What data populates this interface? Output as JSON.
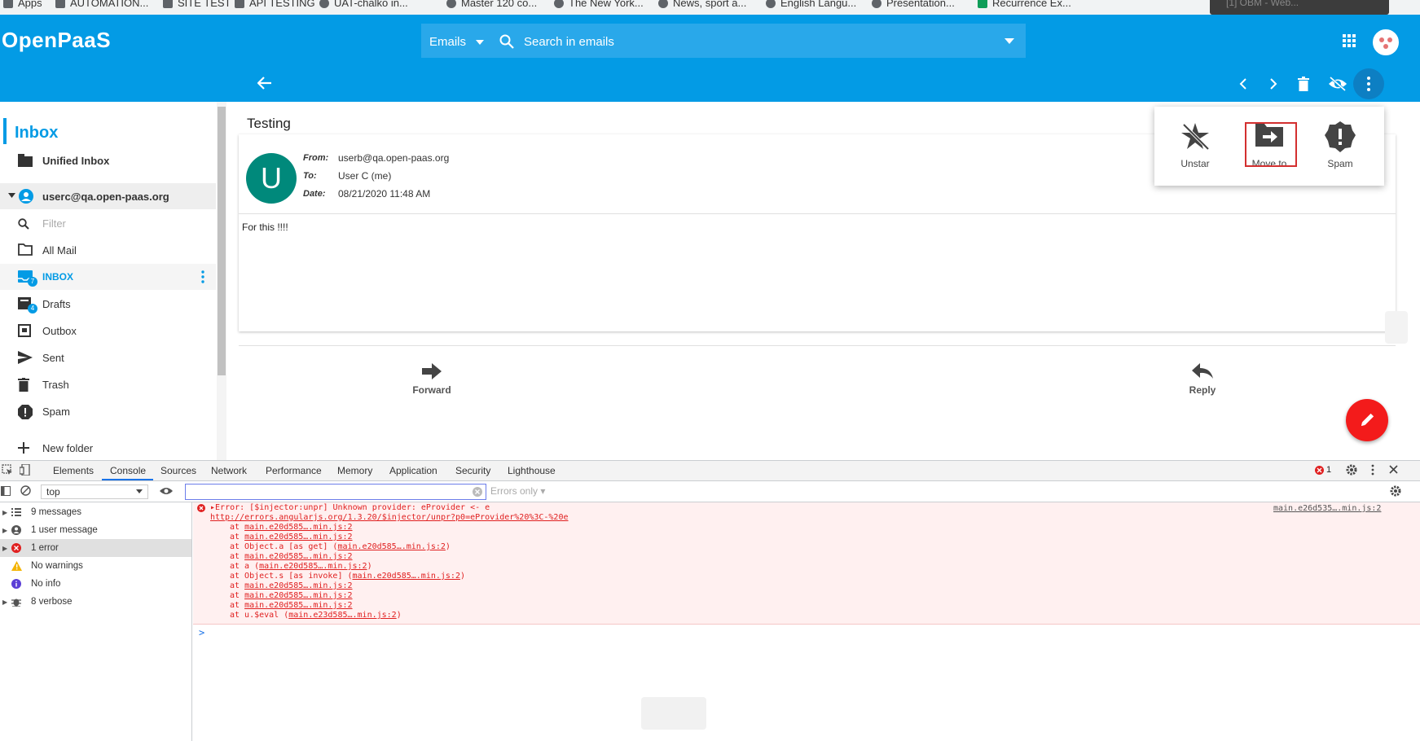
{
  "bookmarks": [
    {
      "label": "Apps"
    },
    {
      "label": "AUTOMATION..."
    },
    {
      "label": "SITE TEST"
    },
    {
      "label": "API TESTING"
    },
    {
      "label": "UAT-chalko in..."
    },
    {
      "label": "Master 120 co..."
    },
    {
      "label": "The New York..."
    },
    {
      "label": "News, sport a..."
    },
    {
      "label": "English Langu..."
    },
    {
      "label": "Presentation..."
    },
    {
      "label": "Recurrence Ex..."
    }
  ],
  "tooltip": "[1] OBM - Web...",
  "app": {
    "logo": "OpenPaaS",
    "search_scope": "Emails",
    "search_placeholder": "Search in emails"
  },
  "sidebar": {
    "title": "Inbox",
    "unified": "Unified Inbox",
    "account": "userc@qa.open-paas.org",
    "filter_placeholder": "Filter",
    "folders": [
      {
        "label": "All Mail",
        "icon": "folder-icon"
      },
      {
        "label": "INBOX",
        "icon": "inbox-icon",
        "badge": "7"
      },
      {
        "label": "Drafts",
        "icon": "drafts-icon",
        "badge": "4"
      },
      {
        "label": "Outbox",
        "icon": "outbox-icon"
      },
      {
        "label": "Sent",
        "icon": "send-icon"
      },
      {
        "label": "Trash",
        "icon": "trash-icon"
      },
      {
        "label": "Spam",
        "icon": "spam-icon"
      }
    ],
    "new_folder": "New folder"
  },
  "mail": {
    "subject": "Testing",
    "avatar_letter": "U",
    "from_label": "From:",
    "from": "userb@qa.open-paas.org",
    "to_label": "To:",
    "to": "User C (me)",
    "date_label": "Date:",
    "date": "08/21/2020 11:48 AM",
    "body": "For this !!!!",
    "forward": "Forward",
    "reply": "Reply"
  },
  "menu": {
    "unstar": "Unstar",
    "move_to": "Move to",
    "spam": "Spam"
  },
  "devtools": {
    "tabs": [
      "Elements",
      "Console",
      "Sources",
      "Network",
      "Performance",
      "Memory",
      "Application",
      "Security",
      "Lighthouse"
    ],
    "error_count": "1",
    "context": "top",
    "levels": "Errors only",
    "side": [
      {
        "label": "9 messages"
      },
      {
        "label": "1 user message"
      },
      {
        "label": "1 error"
      },
      {
        "label": "No warnings"
      },
      {
        "label": "No info"
      },
      {
        "label": "8 verbose"
      }
    ],
    "error_head": "Error: [$injector:unpr] Unknown provider: eProvider <- e",
    "error_url": "http://errors.angularjs.org/1.3.20/$injector/unpr?p0=eProvider%20%3C-%20e",
    "error_source": "main.e26d535….min.js:2",
    "stack": [
      {
        "pre": "at ",
        "link": "main.e20d585….min.js:2",
        "post": ""
      },
      {
        "pre": "at ",
        "link": "main.e20d585….min.js:2",
        "post": ""
      },
      {
        "pre": "at Object.a [as get] (",
        "link": "main.e20d585….min.js:2",
        "post": ")"
      },
      {
        "pre": "at ",
        "link": "main.e20d585….min.js:2",
        "post": ""
      },
      {
        "pre": "at a (",
        "link": "main.e20d585….min.js:2",
        "post": ")"
      },
      {
        "pre": "at Object.s [as invoke] (",
        "link": "main.e20d585….min.js:2",
        "post": ")"
      },
      {
        "pre": "at ",
        "link": "main.e20d585….min.js:2",
        "post": ""
      },
      {
        "pre": "at ",
        "link": "main.e20d585….min.js:2",
        "post": ""
      },
      {
        "pre": "at ",
        "link": "main.e20d585….min.js:2",
        "post": ""
      },
      {
        "pre": "at u.$eval (",
        "link": "main.e23d585….min.js:2",
        "post": ")"
      }
    ],
    "prompt": ">"
  },
  "colors": {
    "primary": "#039be5",
    "fab": "#f31b1b",
    "avatar": "#00897b",
    "error_bg": "#fff0f0",
    "highlight_frame": "#d32f2f"
  }
}
